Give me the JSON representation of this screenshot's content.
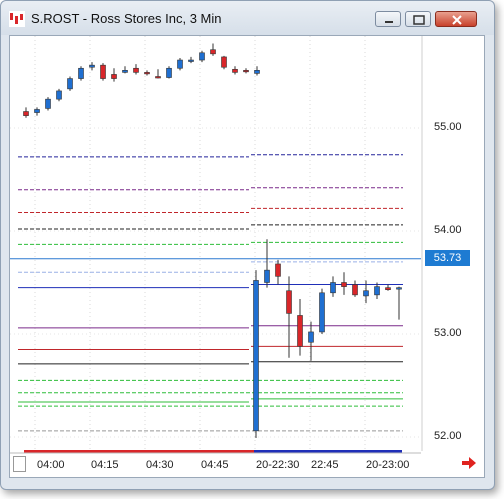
{
  "window": {
    "title": "S.ROST - Ross Stores Inc, 3 Min"
  },
  "price_marker": "53.73",
  "y_axis": {
    "ticks": [
      {
        "label": "55.00",
        "value": 55.0
      },
      {
        "label": "54.00",
        "value": 54.0
      },
      {
        "label": "53.00",
        "value": 53.0
      },
      {
        "label": "52.00",
        "value": 52.0
      }
    ]
  },
  "x_axis": {
    "ticks": [
      "04:00",
      "04:15",
      "04:30",
      "04:45",
      "20-22:30",
      "22:45",
      "20-23:00"
    ]
  },
  "colors": {
    "up": "#1f6fd1",
    "down": "#d9262a",
    "price_line": "#2b78d0"
  },
  "chart_data": {
    "type": "candlestick",
    "title": "S.ROST - Ross Stores Inc, 3 Min",
    "ylim": [
      51.9,
      56.0
    ],
    "last_price": 53.73,
    "candles": [
      {
        "o": 55.16,
        "h": 55.2,
        "l": 55.1,
        "c": 55.12
      },
      {
        "o": 55.15,
        "h": 55.2,
        "l": 55.12,
        "c": 55.18
      },
      {
        "o": 55.19,
        "h": 55.3,
        "l": 55.17,
        "c": 55.28
      },
      {
        "o": 55.28,
        "h": 55.38,
        "l": 55.26,
        "c": 55.36
      },
      {
        "o": 55.38,
        "h": 55.5,
        "l": 55.36,
        "c": 55.48
      },
      {
        "o": 55.48,
        "h": 55.6,
        "l": 55.46,
        "c": 55.58
      },
      {
        "o": 55.59,
        "h": 55.64,
        "l": 55.56,
        "c": 55.61
      },
      {
        "o": 55.61,
        "h": 55.63,
        "l": 55.46,
        "c": 55.48
      },
      {
        "o": 55.52,
        "h": 55.58,
        "l": 55.45,
        "c": 55.48
      },
      {
        "o": 55.54,
        "h": 55.6,
        "l": 55.53,
        "c": 55.56
      },
      {
        "o": 55.58,
        "h": 55.62,
        "l": 55.52,
        "c": 55.54
      },
      {
        "o": 55.54,
        "h": 55.56,
        "l": 55.51,
        "c": 55.53
      },
      {
        "o": 55.5,
        "h": 55.57,
        "l": 55.48,
        "c": 55.49
      },
      {
        "o": 55.49,
        "h": 55.6,
        "l": 55.48,
        "c": 55.58
      },
      {
        "o": 55.58,
        "h": 55.68,
        "l": 55.56,
        "c": 55.66
      },
      {
        "o": 55.65,
        "h": 55.69,
        "l": 55.63,
        "c": 55.66
      },
      {
        "o": 55.66,
        "h": 55.75,
        "l": 55.64,
        "c": 55.73
      },
      {
        "o": 55.76,
        "h": 55.82,
        "l": 55.7,
        "c": 55.72
      },
      {
        "o": 55.69,
        "h": 55.7,
        "l": 55.57,
        "c": 55.59
      },
      {
        "o": 55.57,
        "h": 55.6,
        "l": 55.52,
        "c": 55.54
      },
      {
        "o": 55.56,
        "h": 55.58,
        "l": 55.53,
        "c": 55.55
      },
      {
        "o": 55.53,
        "h": 55.6,
        "l": 55.51,
        "c": 55.56
      },
      {
        "o": 52.06,
        "h": 53.62,
        "l": 51.99,
        "c": 53.52
      },
      {
        "o": 53.5,
        "h": 53.92,
        "l": 53.45,
        "c": 53.62
      },
      {
        "o": 53.68,
        "h": 53.72,
        "l": 53.48,
        "c": 53.56
      },
      {
        "o": 53.42,
        "h": 53.56,
        "l": 52.77,
        "c": 53.2
      },
      {
        "o": 53.18,
        "h": 53.34,
        "l": 52.79,
        "c": 52.88
      },
      {
        "o": 52.92,
        "h": 53.12,
        "l": 52.74,
        "c": 53.02
      },
      {
        "o": 53.02,
        "h": 53.44,
        "l": 53.0,
        "c": 53.4
      },
      {
        "o": 53.4,
        "h": 53.56,
        "l": 53.36,
        "c": 53.5
      },
      {
        "o": 53.5,
        "h": 53.6,
        "l": 53.38,
        "c": 53.46
      },
      {
        "o": 53.48,
        "h": 53.52,
        "l": 53.36,
        "c": 53.38
      },
      {
        "o": 53.37,
        "h": 53.52,
        "l": 53.3,
        "c": 53.42
      },
      {
        "o": 53.38,
        "h": 53.5,
        "l": 53.34,
        "c": 53.46
      },
      {
        "o": 53.45,
        "h": 53.48,
        "l": 53.42,
        "c": 53.43
      },
      {
        "o": 53.44,
        "h": 53.46,
        "l": 53.14,
        "c": 53.45
      }
    ],
    "pivot_levels_session1": [
      {
        "value": 54.72,
        "color": "#23239a",
        "dash": true
      },
      {
        "value": 54.4,
        "color": "#7a2a8a",
        "dash": true
      },
      {
        "value": 54.18,
        "color": "#c0262b",
        "dash": true
      },
      {
        "value": 54.02,
        "color": "#222222",
        "dash": true
      },
      {
        "value": 53.87,
        "color": "#2fbd3a",
        "dash": true
      },
      {
        "value": 53.6,
        "color": "#9ab0e6",
        "dash": true
      }
    ],
    "pivot_levels_session2": [
      {
        "value": 54.74,
        "color": "#23239a",
        "dash": true
      },
      {
        "value": 54.42,
        "color": "#7a2a8a",
        "dash": true
      },
      {
        "value": 54.22,
        "color": "#c0262b",
        "dash": true
      },
      {
        "value": 54.06,
        "color": "#222222",
        "dash": true
      },
      {
        "value": 53.89,
        "color": "#2fbd3a",
        "dash": true
      },
      {
        "value": 53.7,
        "color": "#9ab0e6",
        "dash": true
      }
    ],
    "solid_levels_session1": [
      {
        "value": 53.45,
        "color": "#1f2fb8"
      },
      {
        "value": 53.06,
        "color": "#7a2a8a"
      },
      {
        "value": 52.85,
        "color": "#c0262b"
      },
      {
        "value": 52.71,
        "color": "#222222"
      },
      {
        "value": 52.34,
        "color": "#2fbd3a"
      }
    ],
    "solid_levels_session2": [
      {
        "value": 53.48,
        "color": "#1f2fb8"
      },
      {
        "value": 53.08,
        "color": "#7a2a8a"
      },
      {
        "value": 52.88,
        "color": "#c0262b"
      },
      {
        "value": 52.73,
        "color": "#222222"
      },
      {
        "value": 52.37,
        "color": "#2fbd3a"
      }
    ],
    "lower_dashed_levels": [
      {
        "value": 52.55,
        "color": "#2fbd3a"
      },
      {
        "value": 52.43,
        "color": "#2fbd3a"
      },
      {
        "value": 52.3,
        "color": "#2fbd3a"
      },
      {
        "value": 52.06,
        "color": "#999999"
      }
    ]
  }
}
